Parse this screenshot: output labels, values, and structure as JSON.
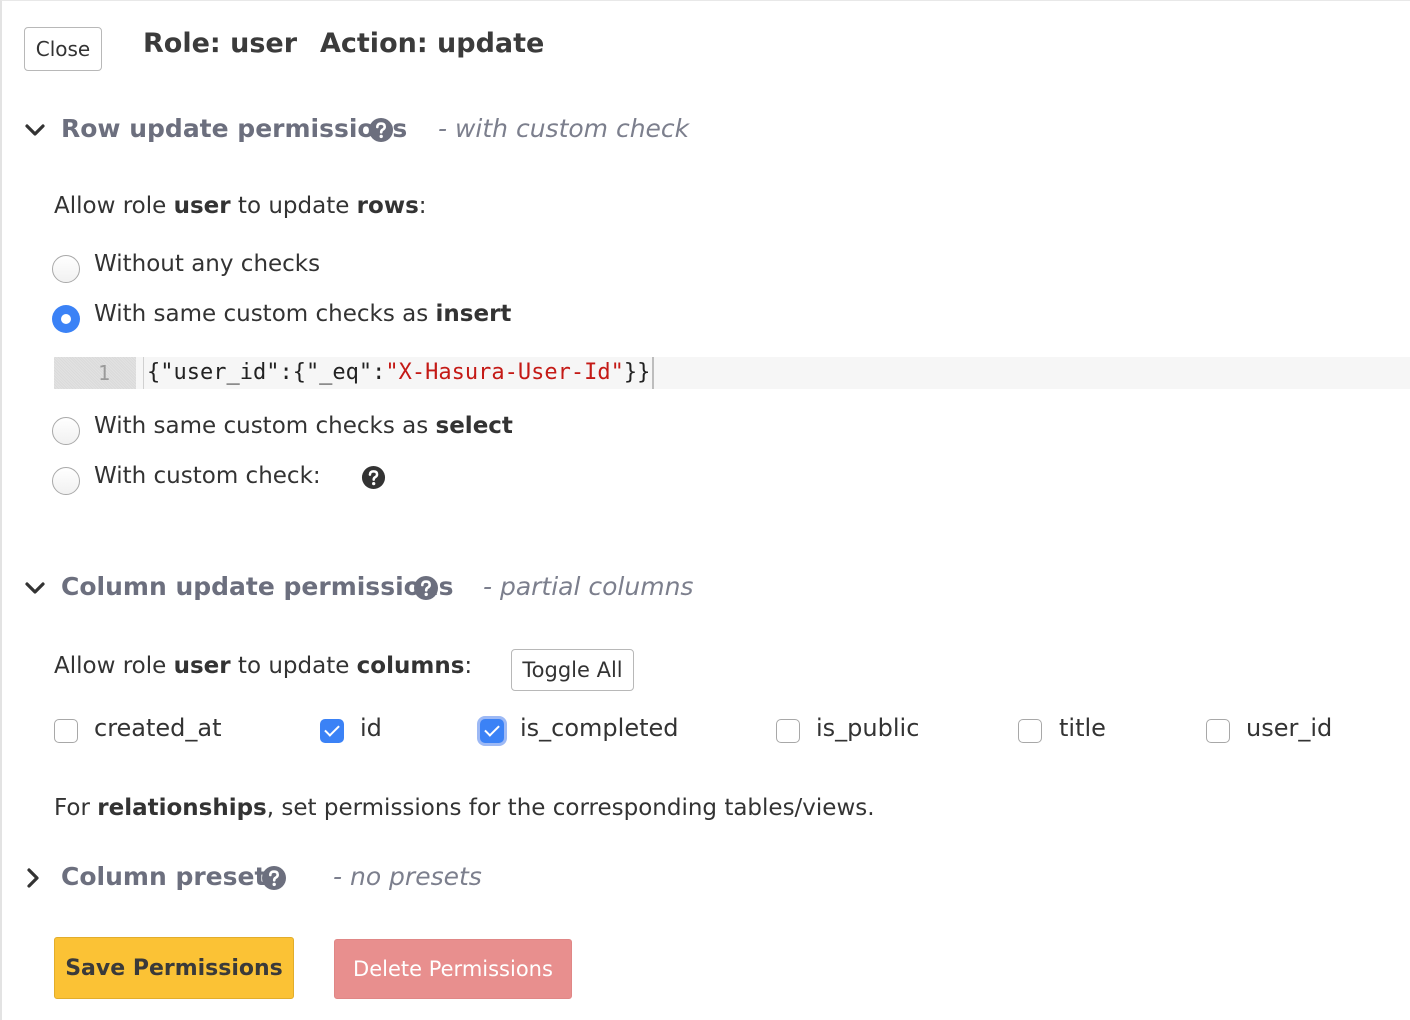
{
  "header": {
    "close_label": "Close",
    "role_label": "Role: user",
    "action_label": "Action: update"
  },
  "row_section": {
    "title": "Row update permissions",
    "subtitle": "- with custom check",
    "allow_prefix": "Allow role ",
    "allow_role": "user",
    "allow_middle": " to update ",
    "allow_target": "rows",
    "allow_suffix": ":",
    "options": {
      "none": {
        "label": "Without any checks",
        "checked": false
      },
      "insert": {
        "label_prefix": "With same custom checks as ",
        "label_bold": "insert",
        "checked": true
      },
      "select": {
        "label_prefix": "With same custom checks as ",
        "label_bold": "select",
        "checked": false
      },
      "custom": {
        "label": "With custom check:",
        "checked": false
      }
    },
    "editor": {
      "line_number": "1",
      "code_prefix": "{\"user_id\":{\"_eq\":",
      "code_string": "\"X-Hasura-User-Id\"",
      "code_suffix": "}}"
    }
  },
  "column_section": {
    "title": "Column update permissions",
    "subtitle": "- partial columns",
    "allow_prefix": "Allow role ",
    "allow_role": "user",
    "allow_middle": " to update ",
    "allow_target": "columns",
    "allow_suffix": ":",
    "toggle_all_label": "Toggle All",
    "columns": [
      {
        "name": "created_at",
        "checked": false
      },
      {
        "name": "id",
        "checked": true
      },
      {
        "name": "is_completed",
        "checked": true
      },
      {
        "name": "is_public",
        "checked": false
      },
      {
        "name": "title",
        "checked": false
      },
      {
        "name": "user_id",
        "checked": false
      }
    ],
    "relationships_prefix": "For ",
    "relationships_bold": "relationships",
    "relationships_suffix": ", set permissions for the corresponding tables/views."
  },
  "presets_section": {
    "title": "Column presets",
    "subtitle": "- no presets"
  },
  "actions": {
    "save_label": "Save Permissions",
    "delete_label": "Delete Permissions"
  },
  "colors": {
    "accent_blue": "#3b82f6",
    "save_yellow": "#fbc235",
    "delete_red": "#e88f8e",
    "code_string_red": "#c41a16"
  }
}
